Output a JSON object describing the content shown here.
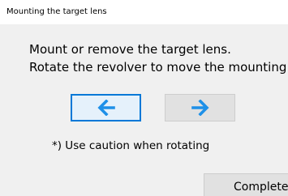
{
  "window": {
    "title": "Mounting the target lens"
  },
  "main": {
    "instruction_line1": "Mount or remove the target lens.",
    "instruction_line2": "Rotate the revolver to move the mounting position.",
    "caution": "*) Use caution when rotating"
  },
  "buttons": {
    "rotate_left_icon": "arrow-left-icon",
    "rotate_right_icon": "arrow-right-icon",
    "complete_label": "Complete"
  },
  "colors": {
    "accent": "#0078d7",
    "arrow": "#1e90e8",
    "window_bg": "#f0f0f0",
    "button_bg": "#e1e1e1",
    "focused_button_bg": "#e5f1fb"
  }
}
